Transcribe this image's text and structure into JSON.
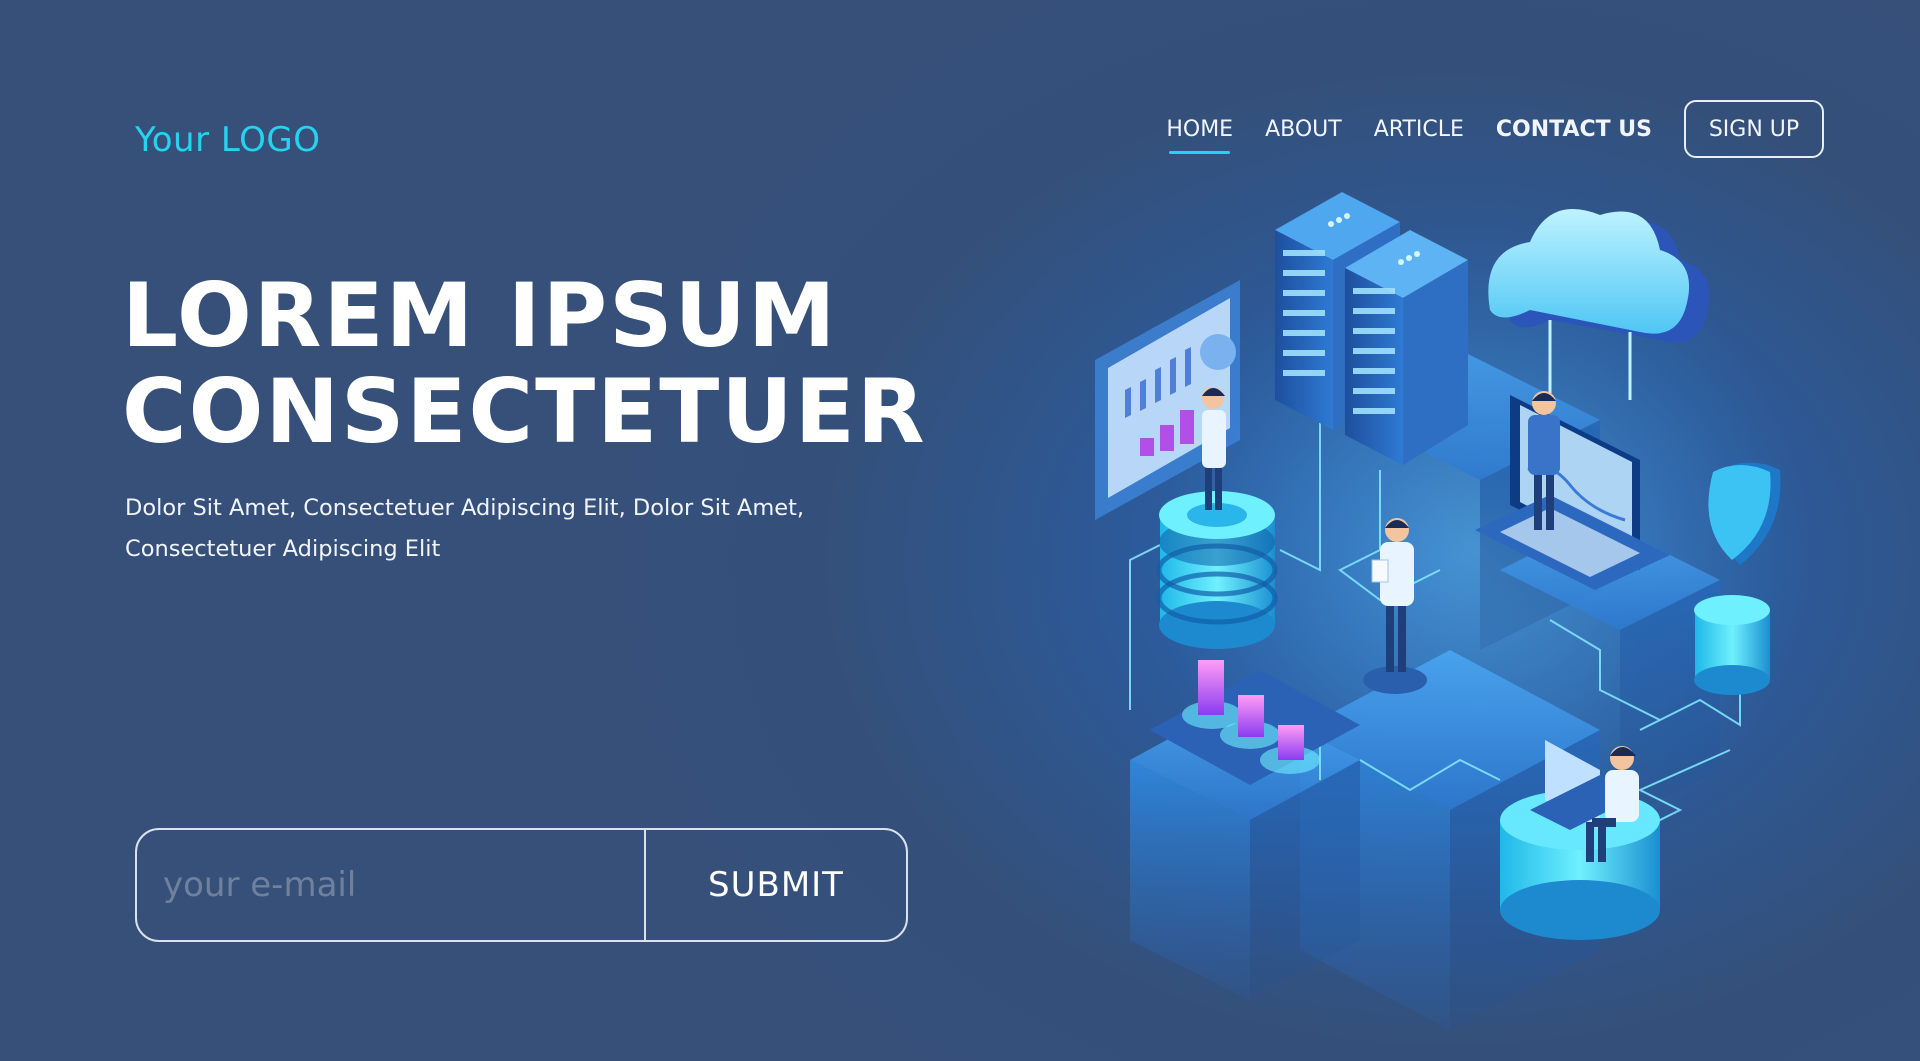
{
  "brand": {
    "logo": "Your LOGO"
  },
  "nav": {
    "items": [
      {
        "label": "HOME",
        "active": true
      },
      {
        "label": "ABOUT",
        "active": false
      },
      {
        "label": "ARTICLE",
        "active": false
      },
      {
        "label": "CONTACT US",
        "active": false
      }
    ],
    "signup_label": "SIGN UP"
  },
  "hero": {
    "title_line1": "LOREM IPSUM",
    "title_line2": "CONSECTETUER",
    "subtitle_line1": "Dolor Sit Amet, Consectetuer Adipiscing Elit, Dolor Sit Amet,",
    "subtitle_line2": "Consectetuer Adipiscing Elit"
  },
  "form": {
    "email_placeholder": "your e-mail",
    "email_value": "",
    "submit_label": "SUBMIT"
  },
  "illustration": {
    "icons": [
      "server-rack-icon",
      "cloud-icon",
      "shield-icon",
      "database-icon",
      "bar-chart-icon",
      "laptop-icon",
      "monitor-icon",
      "analytics-board-icon",
      "person-icon"
    ]
  },
  "colors": {
    "background": "#34507a",
    "accent": "#23d3f0",
    "text": "#ffffff",
    "glow": "#3fb8ff"
  }
}
